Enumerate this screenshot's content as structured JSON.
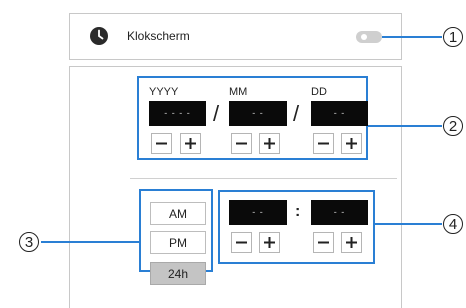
{
  "header": {
    "title": "Klokscherm",
    "toggle_state": "off"
  },
  "date": {
    "year_label": "YYYY",
    "month_label": "MM",
    "day_label": "DD",
    "year_value": "- - - -",
    "month_value": "- -",
    "day_value": "- -",
    "separator": "/"
  },
  "time_mode": {
    "am_label": "AM",
    "pm_label": "PM",
    "h24_label": "24h",
    "selected": "24h"
  },
  "time": {
    "hour_value": "- -",
    "minute_value": "- -",
    "separator": ":"
  },
  "callouts": {
    "c1": "1",
    "c2": "2",
    "c3": "3",
    "c4": "4"
  },
  "colors": {
    "highlight": "#2a7fd4",
    "value_box": "#0a0a0a",
    "active_button": "#c4c4c4"
  },
  "icons": {
    "clock": "clock-icon",
    "minus": "minus-icon",
    "plus": "plus-icon"
  }
}
